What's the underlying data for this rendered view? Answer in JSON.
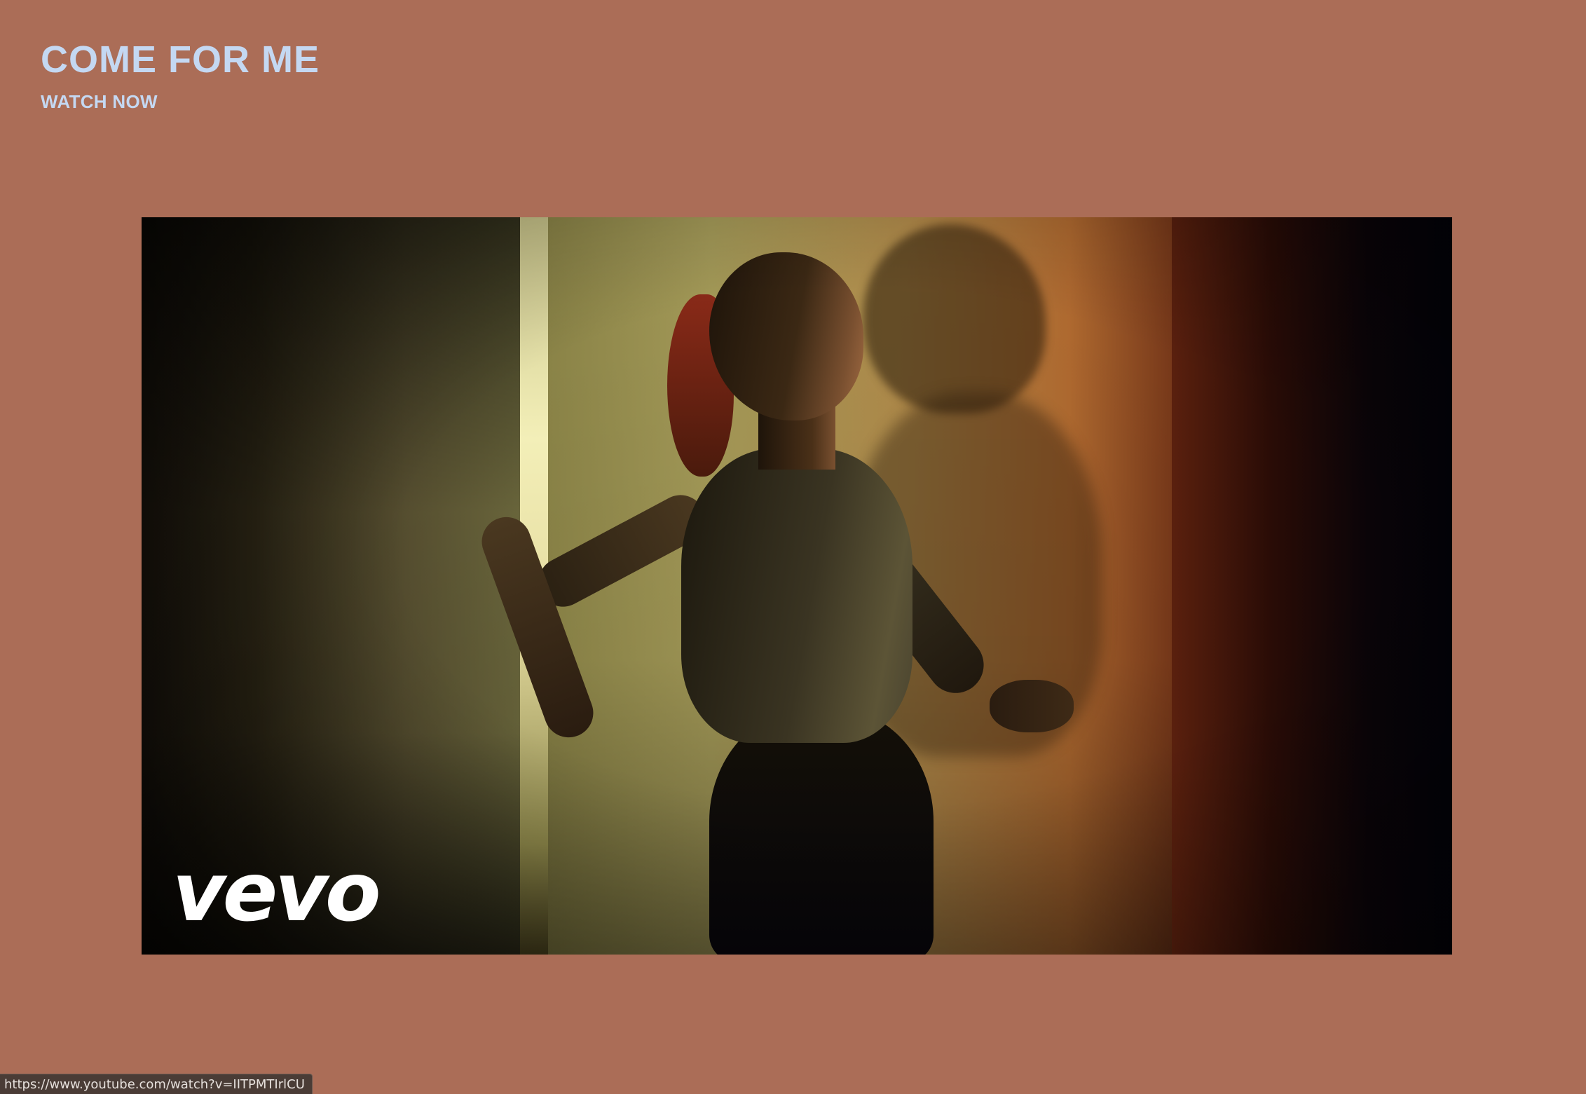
{
  "header": {
    "title": "COME FOR ME",
    "cta_label": "WATCH NOW"
  },
  "video": {
    "logo_text": "vevo",
    "thumbnail": "music-video-still-woman-silhouette"
  },
  "status_bar": {
    "url": "https://www.youtube.com/watch?v=IITPMTIrlCU"
  },
  "colors": {
    "background": "#ab6d57",
    "title": "#c4d8f2",
    "logo": "#ffffff"
  }
}
